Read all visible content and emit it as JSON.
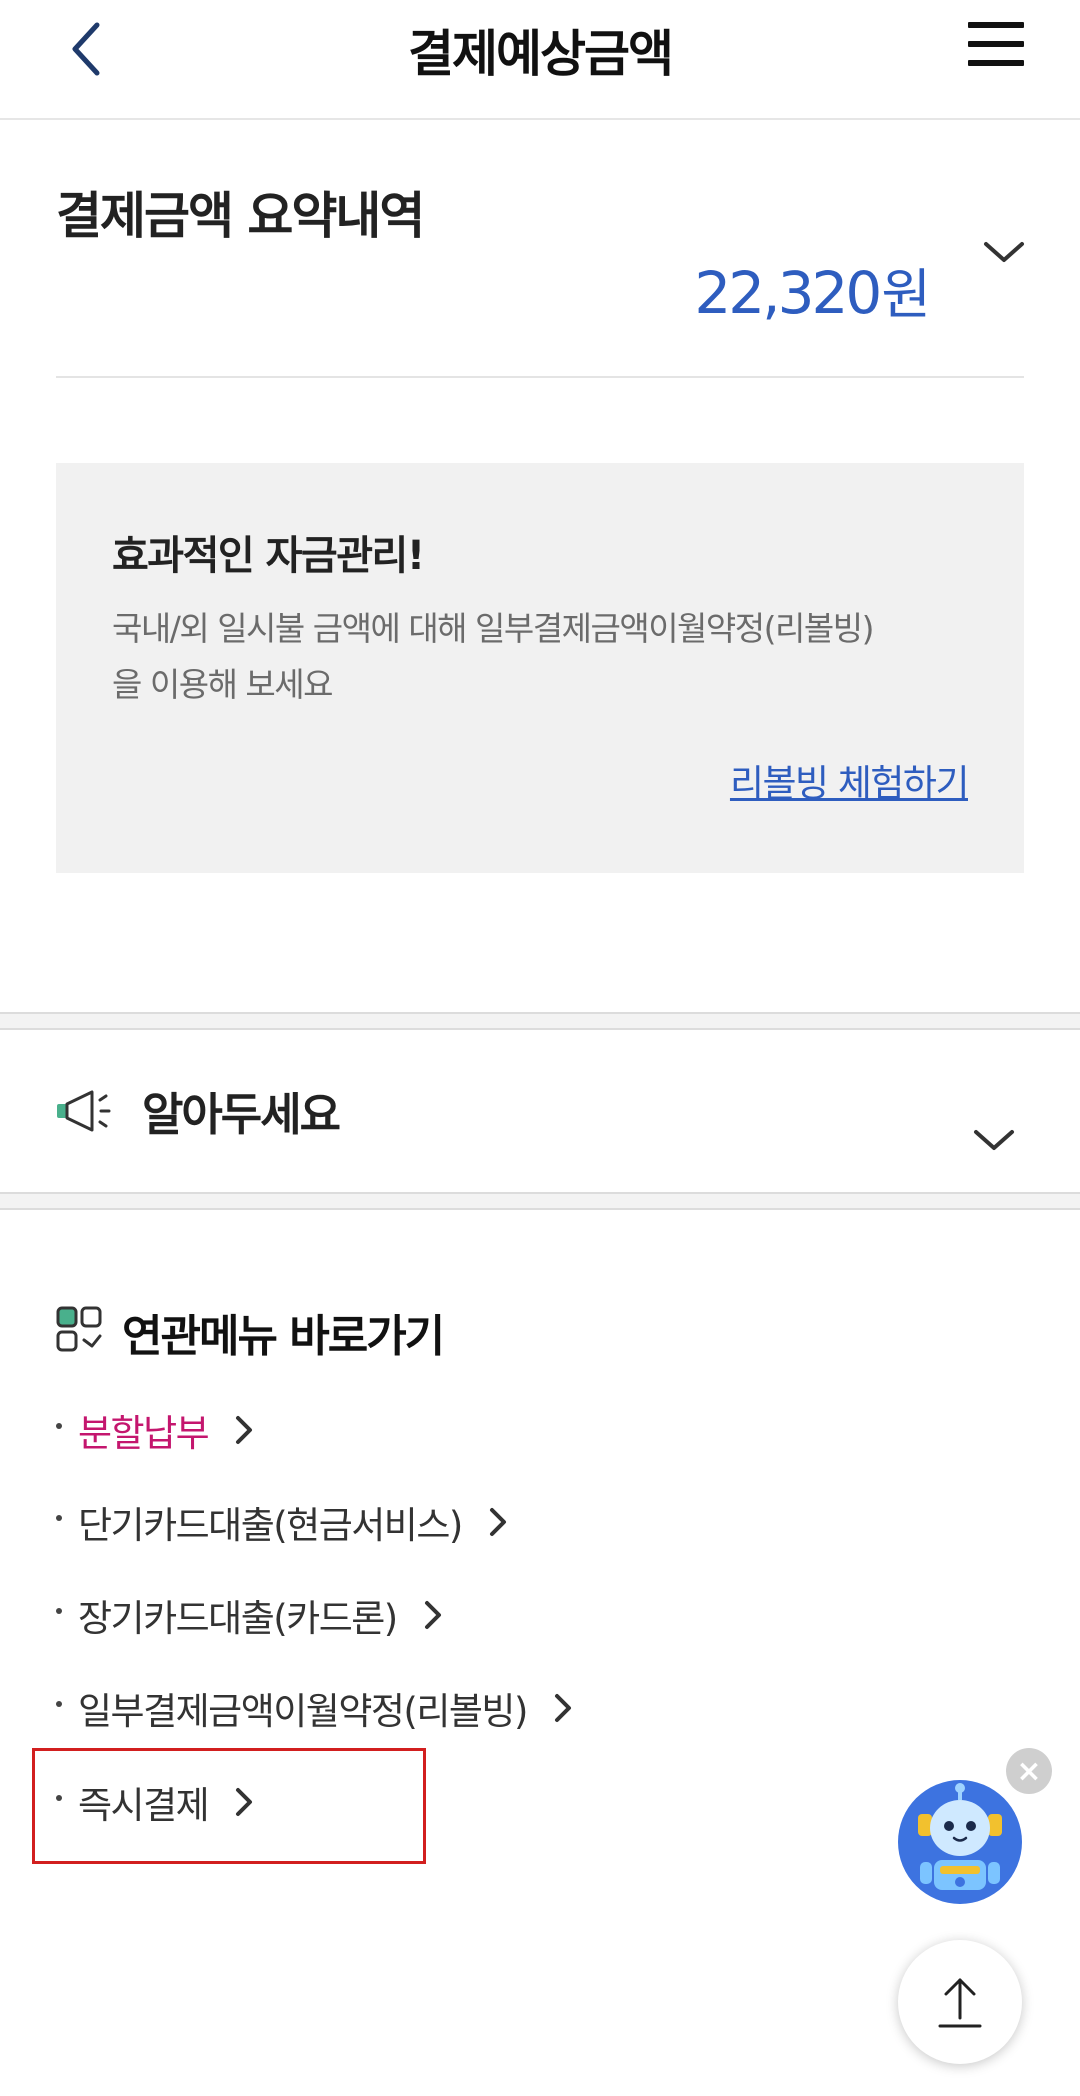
{
  "header": {
    "title": "결제예상금액",
    "back_icon": "chevron-left-icon",
    "menu_icon": "hamburger-menu-icon"
  },
  "summary": {
    "title": "결제금액 요약내역",
    "amount": "22,320",
    "unit": "원",
    "amount_color": "#2e5dbf"
  },
  "promo": {
    "title": "효과적인 자금관리!",
    "desc_line1": "국내/외 일시불 금액에 대해 일부결제금액이월약정(리볼빙)",
    "desc_line2": "을 이용해 보세요",
    "link": "리볼빙 체험하기"
  },
  "notice": {
    "title": "알아두세요",
    "icon": "megaphone-icon"
  },
  "related": {
    "title": "연관메뉴 바로가기",
    "icon": "grid-menu-icon",
    "items": [
      {
        "label": "분할납부",
        "color": "#c4166e"
      },
      {
        "label": "단기카드대출(현금서비스)"
      },
      {
        "label": "장기카드대출(카드론)"
      },
      {
        "label": "일부결제금액이월약정(리볼빙)"
      },
      {
        "label": "즉시결제"
      }
    ]
  },
  "floating": {
    "chatbot_icon": "robot-chatbot-icon",
    "close_label": "×",
    "scroll_top_icon": "arrow-up-icon"
  }
}
